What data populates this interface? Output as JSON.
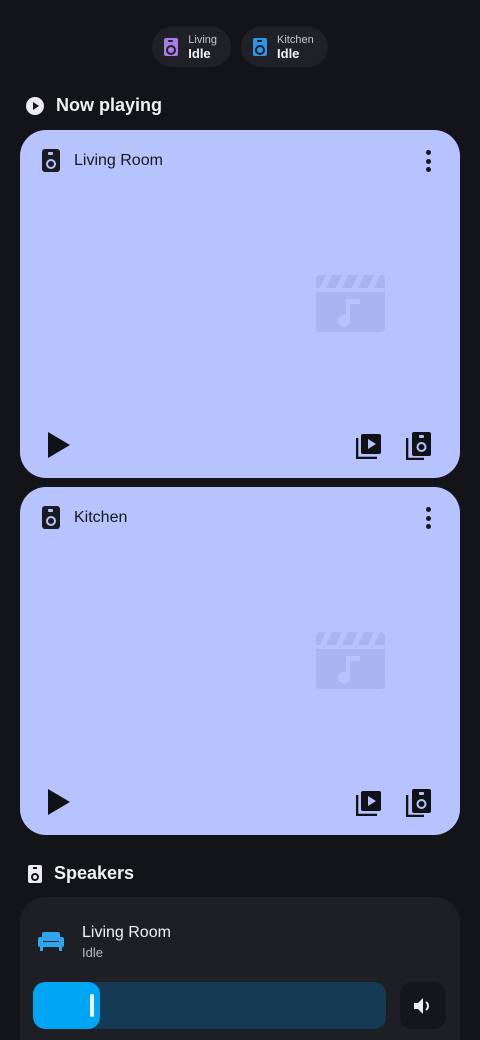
{
  "chips": [
    {
      "name": "Living",
      "status": "Idle",
      "icon": "speaker-icon",
      "color": "#a77ee6"
    },
    {
      "name": "Kitchen",
      "status": "Idle",
      "icon": "speaker-icon",
      "color": "#2f95e6"
    }
  ],
  "now_playing": {
    "title": "Now playing",
    "icon": "play-circle-icon",
    "players": [
      {
        "name": "Living Room",
        "icon": "speaker-icon",
        "artwork_icon": "music-video-icon"
      },
      {
        "name": "Kitchen",
        "icon": "speaker-icon",
        "artwork_icon": "music-video-icon"
      }
    ]
  },
  "speakers": {
    "title": "Speakers",
    "icon": "speaker-icon",
    "items": [
      {
        "name": "Living Room",
        "status": "Idle",
        "icon": "sofa-icon",
        "volume_percent": 19
      }
    ]
  },
  "colors": {
    "background": "#131418",
    "card": "#b6c3ff",
    "accent": "#00a5f3",
    "volume_track": "#143a56"
  }
}
